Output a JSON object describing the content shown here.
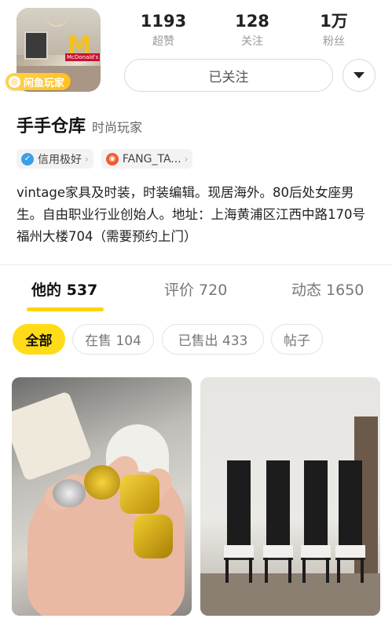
{
  "profile": {
    "badge_label": "闲鱼玩家",
    "avatar_store_text": "McDonald's",
    "stats": [
      {
        "value": "1193",
        "label": "超赞"
      },
      {
        "value": "128",
        "label": "关注"
      },
      {
        "value": "1万",
        "label": "粉丝"
      }
    ],
    "follow_label": "已关注",
    "name": "手手仓库",
    "name_tag": "时尚玩家",
    "chips": [
      {
        "label": "信用极好",
        "icon": "credit-icon",
        "color": "#3aa0e8"
      },
      {
        "label": "FANG_TA...",
        "icon": "weibo-icon",
        "color": "#f15a2a"
      }
    ],
    "bio": "vintage家具及时装，时装编辑。现居海外。80后处女座男生。自由职业行业创始人。地址：上海黄浦区江西中路170号福州大楼704（需要预约上门）"
  },
  "tabs": [
    {
      "label": "他的 537",
      "active": true
    },
    {
      "label": "评价 720",
      "active": false
    },
    {
      "label": "动态 1650",
      "active": false
    }
  ],
  "filters": [
    {
      "label": "全部",
      "active": true
    },
    {
      "label": "在售 104",
      "active": false
    },
    {
      "label": "已售出 433",
      "active": false
    },
    {
      "label": "帖子",
      "active": false
    }
  ],
  "colors": {
    "accent": "#ffdc17",
    "text_muted": "#9a9a9a"
  }
}
